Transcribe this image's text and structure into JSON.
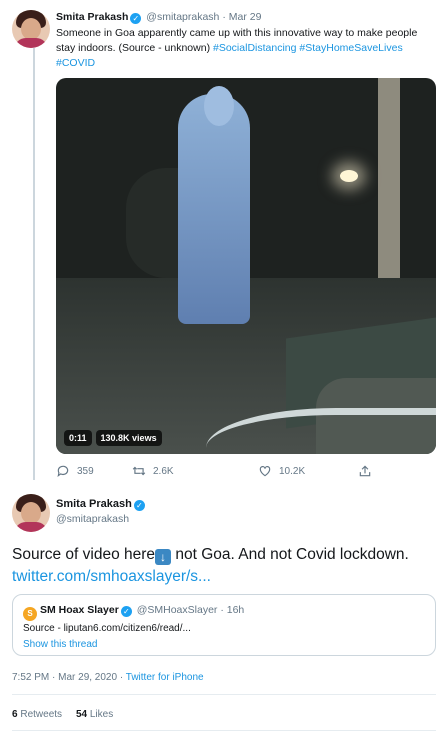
{
  "tweet1": {
    "author_name": "Smita Prakash",
    "handle": "@smitaprakash",
    "date": "Mar 29",
    "text": "Someone in Goa apparently came up with this innovative way to make people stay indoors. (Source - unknown)",
    "hashtags": [
      "#SocialDistancing",
      "#StayHomeSaveLives",
      "#COVID"
    ],
    "video": {
      "duration": "0:11",
      "views": "130.8K views"
    },
    "actions": {
      "replies": "359",
      "retweets": "2.6K",
      "likes": "10.2K"
    }
  },
  "tweet2": {
    "author_name": "Smita Prakash",
    "handle": "@smitaprakash",
    "text_part1": "Source of video here",
    "text_part2": " not Goa. And not Covid lockdown. ",
    "link": "twitter.com/smhoaxslayer/s...",
    "quote": {
      "name": "SM Hoax Slayer",
      "handle": "@SMHoaxSlayer",
      "time": "16h",
      "text": "Source - liputan6.com/citizen6/read/...",
      "show_thread": "Show this thread"
    },
    "timestamp": "7:52 PM · Mar 29, 2020",
    "source": "Twitter for iPhone",
    "retweets_count": "6",
    "retweets_label": "Retweets",
    "likes_count": "54",
    "likes_label": "Likes"
  },
  "colors": {
    "accent": "#1da1f2",
    "link": "#1b95e0",
    "muted": "#657786"
  },
  "icons": [
    "verified-icon",
    "reply-icon",
    "retweet-icon",
    "like-icon",
    "share-icon",
    "down-arrow-emoji"
  ]
}
